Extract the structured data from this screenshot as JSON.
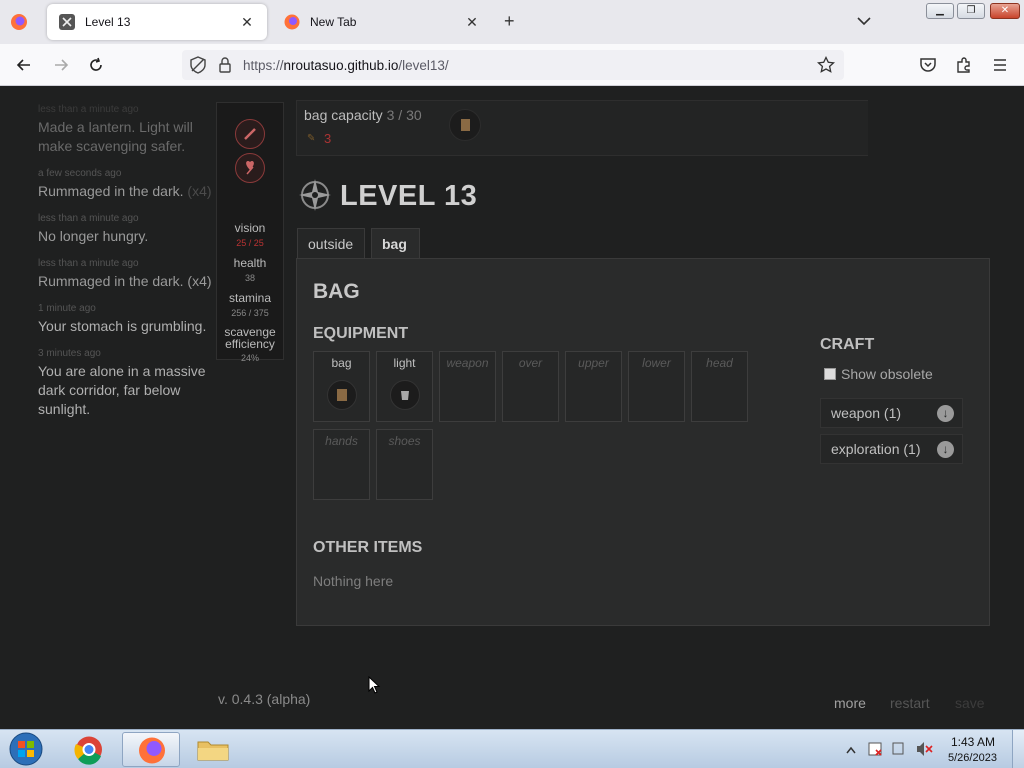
{
  "browser": {
    "tabs": [
      {
        "title": "Level 13",
        "active": true
      },
      {
        "title": "New Tab",
        "active": false
      }
    ],
    "url_prefix": "https://",
    "url_domain": "nroutasuo.github.io",
    "url_path": "/level13/"
  },
  "log": [
    {
      "time": "less than a minute ago",
      "text": "Made a lantern. Light will make scavenging safer.",
      "count": ""
    },
    {
      "time": "a few seconds ago",
      "text": "Rummaged in the dark.",
      "count": "(x4)"
    },
    {
      "time": "less than a minute ago",
      "text": "No longer hungry.",
      "count": ""
    },
    {
      "time": "less than a minute ago",
      "text": "Rummaged in the dark.",
      "count": "(x4)"
    },
    {
      "time": "1 minute ago",
      "text": "Your stomach is grumbling.",
      "count": ""
    },
    {
      "time": "3 minutes ago",
      "text": "You are alone in a massive dark corridor, far below sunlight.",
      "count": ""
    }
  ],
  "stats": {
    "vision_label": "vision",
    "vision_value": "25 / 25",
    "health_label": "health",
    "health_value": "38",
    "stamina_label": "stamina",
    "stamina_value": "256 / 375",
    "scavenge_label": "scavenge efficiency",
    "scavenge_value": "24%"
  },
  "bag_capacity": {
    "label": "bag capacity",
    "value": "3 / 30",
    "resource_count": "3"
  },
  "level": {
    "title": "LEVEL 13"
  },
  "tabs": {
    "outside": "outside",
    "bag": "bag"
  },
  "bag_panel": {
    "title": "BAG",
    "equipment_title": "EQUIPMENT",
    "slots": [
      "bag",
      "light",
      "weapon",
      "over",
      "upper",
      "lower",
      "head",
      "hands",
      "shoes"
    ],
    "other_title": "OTHER ITEMS",
    "other_empty": "Nothing here"
  },
  "craft": {
    "title": "CRAFT",
    "show_obsolete": "Show obsolete",
    "buttons": [
      "weapon (1)",
      "exploration (1)"
    ]
  },
  "footer": {
    "version": "v. 0.4.3 (alpha)",
    "more": "more",
    "restart": "restart",
    "save": "save"
  },
  "taskbar": {
    "time": "1:43 AM",
    "date": "5/26/2023"
  },
  "colors": {
    "game_bg": "#1f2020",
    "panel_bg": "#2a2b2b",
    "accent_red": "#b33333",
    "taskbar": "#c4d5e8"
  }
}
